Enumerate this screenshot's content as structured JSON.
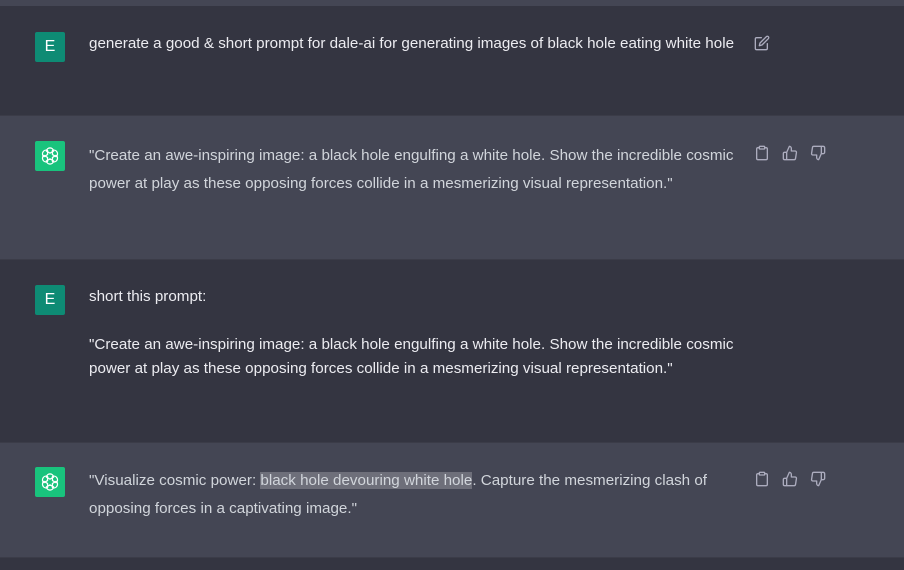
{
  "conversation": {
    "messages": [
      {
        "role": "user",
        "avatar_letter": "E",
        "text": "generate a good & short prompt for dale-ai for generating images of black hole eating white hole"
      },
      {
        "role": "assistant",
        "text": "\"Create an awe-inspiring image: a black hole engulfing a white hole. Show the incredible cosmic power at play as these opposing forces collide in a mesmerizing visual representation.\""
      },
      {
        "role": "user",
        "avatar_letter": "E",
        "line1": "short this prompt:",
        "line2": "\"Create an awe-inspiring image: a black hole engulfing a white hole. Show the incredible cosmic power at play as these opposing forces collide in a mesmerizing visual representation.\""
      },
      {
        "role": "assistant",
        "text_before": "\"Visualize cosmic power: ",
        "text_highlight": "black hole devouring white hole",
        "text_after": ". Capture the mesmerizing clash of opposing forces in a captivating image.\""
      }
    ]
  },
  "icons": {
    "edit": "edit-icon",
    "copy": "clipboard-icon",
    "like": "thumbs-up-icon",
    "dislike": "thumbs-down-icon"
  },
  "colors": {
    "user_bg": "#343541",
    "assistant_bg": "#444654",
    "user_avatar": "#0e8b74",
    "gpt_avatar": "#19c37d",
    "highlight": "#6e6f7a"
  }
}
